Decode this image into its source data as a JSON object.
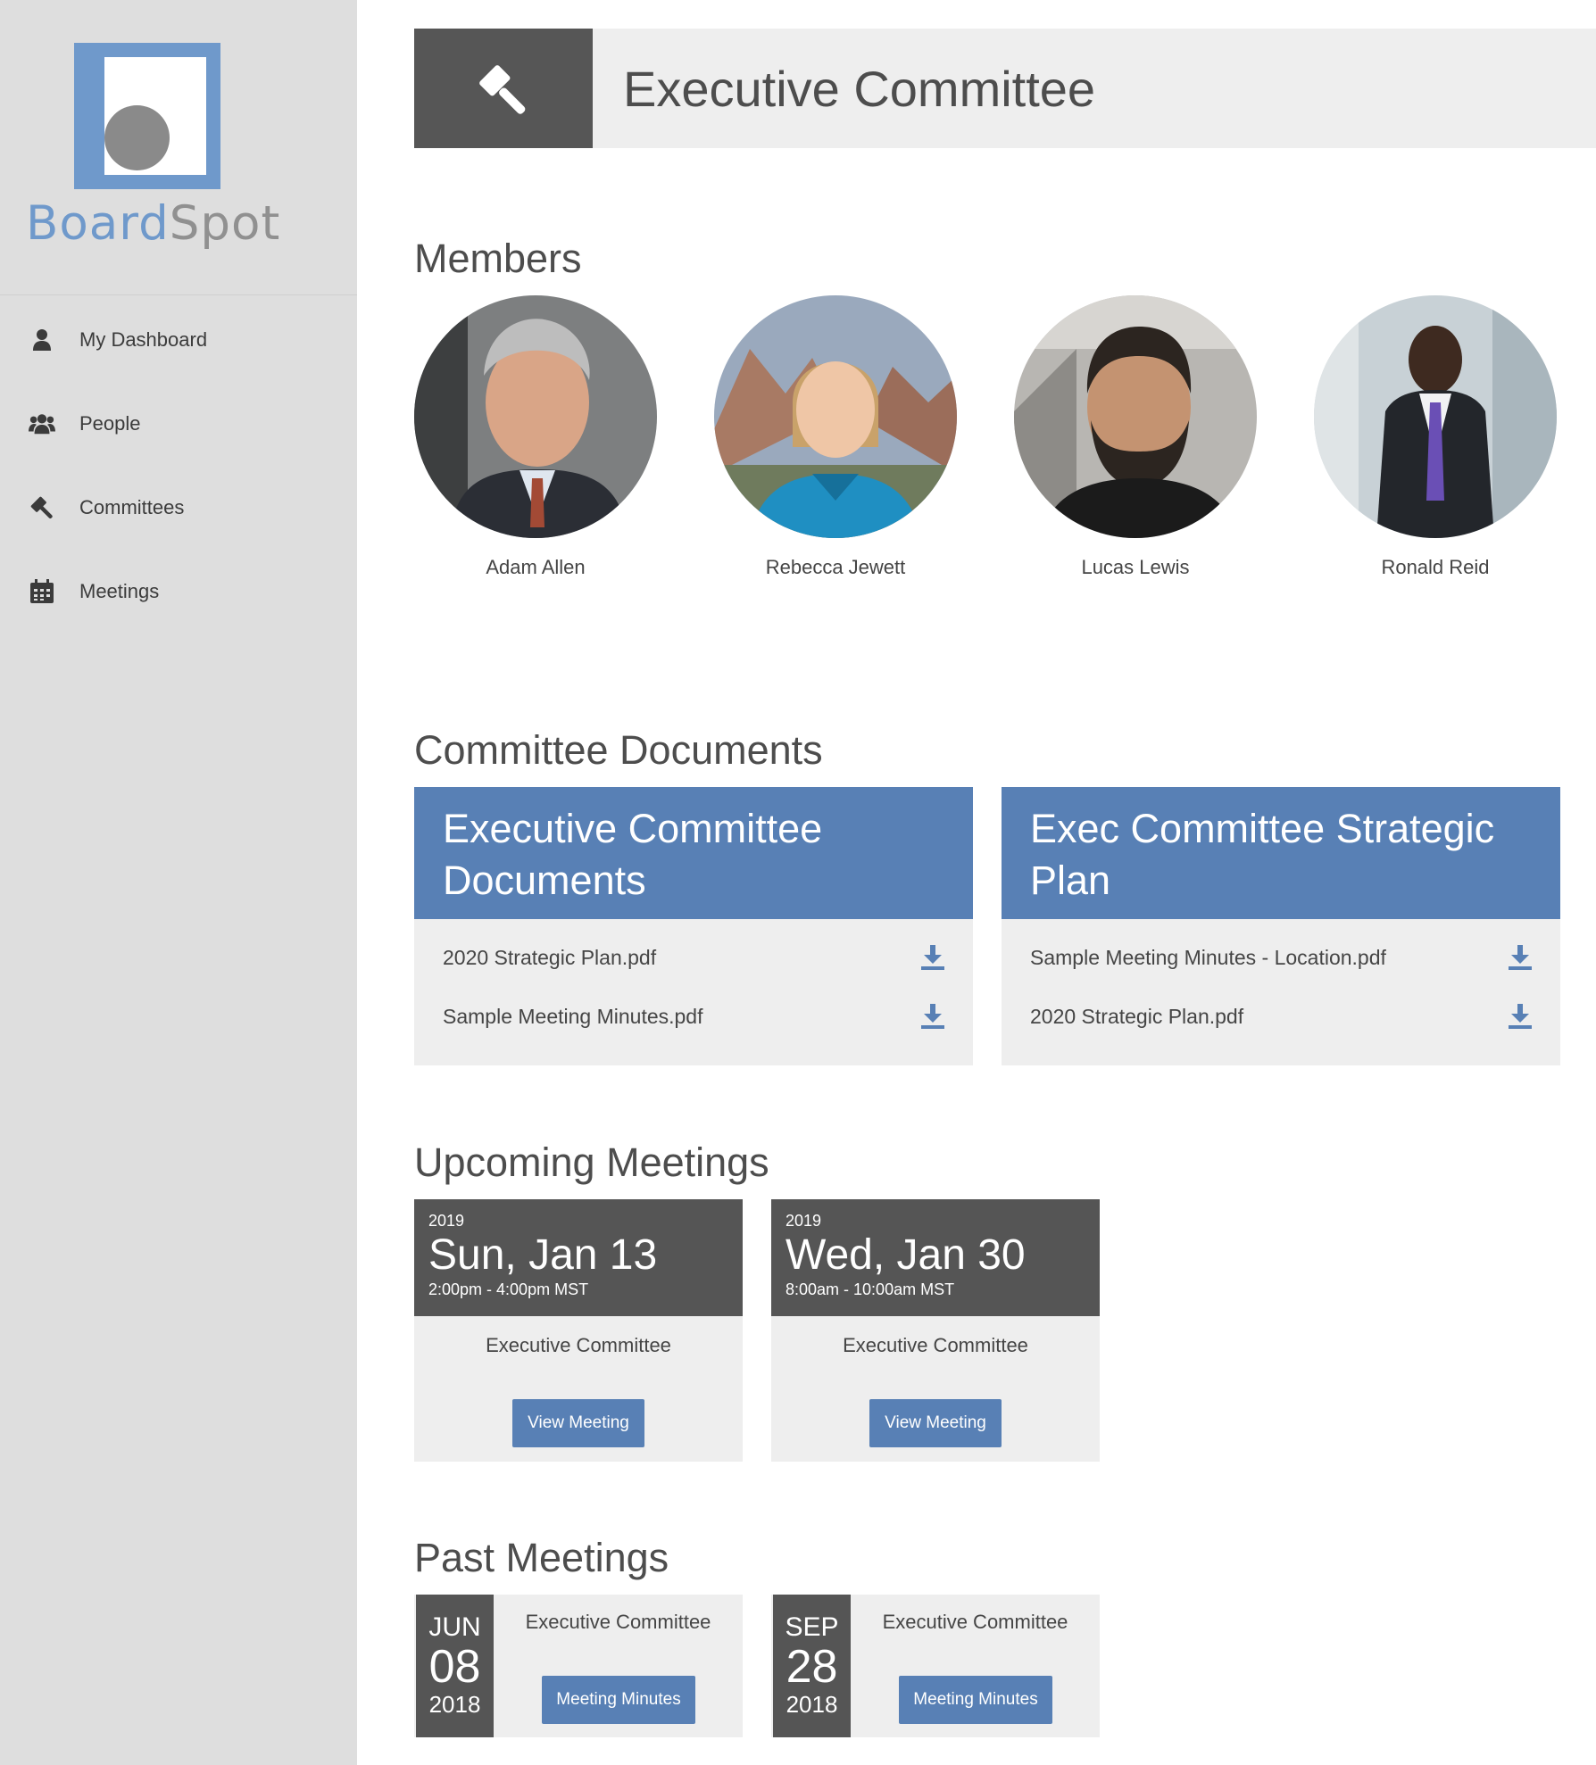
{
  "brand": {
    "part1": "Board",
    "part2": "Spot",
    "primary_color": "#6f99cb",
    "secondary_color": "#909090"
  },
  "sidebar": {
    "items": [
      {
        "label": "My Dashboard",
        "icon": "user-icon"
      },
      {
        "label": "People",
        "icon": "users-icon"
      },
      {
        "label": "Committees",
        "icon": "gavel-icon"
      },
      {
        "label": "Meetings",
        "icon": "calendar-icon"
      }
    ]
  },
  "header": {
    "title": "Executive Committee",
    "icon": "gavel-icon"
  },
  "members": {
    "title": "Members",
    "list": [
      {
        "name": "Adam Allen"
      },
      {
        "name": "Rebecca Jewett"
      },
      {
        "name": "Lucas Lewis"
      },
      {
        "name": "Ronald Reid"
      }
    ]
  },
  "documents": {
    "title": "Committee Documents",
    "groups": [
      {
        "title": "Executive Committee Documents",
        "files": [
          "2020 Strategic Plan.pdf",
          "Sample Meeting Minutes.pdf"
        ]
      },
      {
        "title": "Exec Committee Strategic Plan",
        "files": [
          "Sample Meeting Minutes - Location.pdf",
          "2020 Strategic Plan.pdf"
        ]
      }
    ]
  },
  "upcoming": {
    "title": "Upcoming Meetings",
    "meetings": [
      {
        "year": "2019",
        "date": "Sun, Jan 13",
        "time": "2:00pm - 4:00pm MST",
        "name": "Executive Committee",
        "button": "View Meeting"
      },
      {
        "year": "2019",
        "date": "Wed, Jan 30",
        "time": "8:00am - 10:00am MST",
        "name": "Executive Committee",
        "button": "View Meeting"
      }
    ]
  },
  "past": {
    "title": "Past Meetings",
    "meetings": [
      {
        "month": "JUN",
        "day": "08",
        "year": "2018",
        "name": "Executive Committee",
        "button": "Meeting Minutes"
      },
      {
        "month": "SEP",
        "day": "28",
        "year": "2018",
        "name": "Executive Committee",
        "button": "Meeting Minutes"
      }
    ]
  },
  "colors": {
    "accent": "#5880b5",
    "dark": "#555555",
    "sidebar_bg": "#dedede",
    "panel_bg": "#eeeeee"
  }
}
